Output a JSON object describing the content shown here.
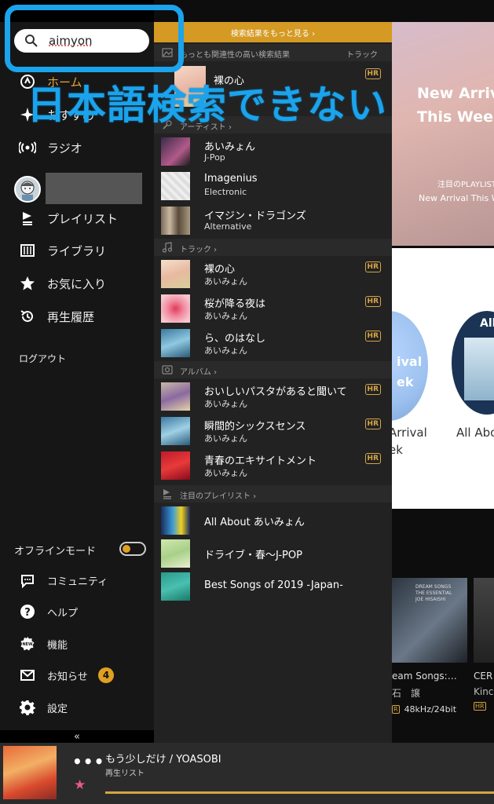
{
  "search": {
    "value": "aimyon",
    "placeholder": ""
  },
  "overlay_caption": "日本語検索できない",
  "sidebar": {
    "nav_top": [
      {
        "label": "ホーム",
        "icon": "home-icon"
      },
      {
        "label": "おすすめ",
        "icon": "sparkle-icon"
      },
      {
        "label": "ラジオ",
        "icon": "radio-icon"
      }
    ],
    "nav_library": [
      {
        "label": "プレイリスト",
        "icon": "playlist-icon"
      },
      {
        "label": "ライブラリ",
        "icon": "library-icon"
      },
      {
        "label": "お気に入り",
        "icon": "star-icon"
      },
      {
        "label": "再生履歴",
        "icon": "history-icon"
      }
    ],
    "logout": "ログアウト",
    "offline_mode": {
      "label": "オフラインモード",
      "enabled": false
    },
    "nav_bottom": [
      {
        "label": "コミュニティ",
        "icon": "community-icon"
      },
      {
        "label": "ヘルプ",
        "icon": "help-icon"
      },
      {
        "label": "機能",
        "icon": "new-icon"
      },
      {
        "label": "お知らせ",
        "icon": "mail-icon",
        "badge": "4"
      },
      {
        "label": "設定",
        "icon": "gear-icon"
      }
    ],
    "collapse_label": "«"
  },
  "dropdown": {
    "more_results": "検索結果をもっと見る ›",
    "top_result": {
      "header": "もっとも関連性の高い検索結果",
      "type_label": "トラック",
      "item": {
        "title": "裸の心",
        "hr": "HR"
      }
    },
    "artists": {
      "header": "アーティスト ›",
      "items": [
        {
          "name": "あいみょん",
          "genre": "J-Pop"
        },
        {
          "name": "Imagenius",
          "genre": "Electronic"
        },
        {
          "name": "イマジン・ドラゴンズ",
          "genre": "Alternative"
        }
      ]
    },
    "tracks": {
      "header": "トラック ›",
      "items": [
        {
          "title": "裸の心",
          "artist": "あいみょん",
          "hr": "HR"
        },
        {
          "title": "桜が降る夜は",
          "artist": "あいみょん",
          "hr": "HR"
        },
        {
          "title": "ら、のはなし",
          "artist": "あいみょん",
          "hr": "HR"
        }
      ]
    },
    "albums": {
      "header": "アルバム ›",
      "items": [
        {
          "title": "おいしいパスタがあると聞いて",
          "artist": "あいみょん",
          "hr": "HR"
        },
        {
          "title": "瞬間的シックスセンス",
          "artist": "あいみょん",
          "hr": "HR"
        },
        {
          "title": "青春のエキサイトメント",
          "artist": "あいみょん",
          "hr": "HR"
        }
      ]
    },
    "playlists": {
      "header": "注目のプレイリスト ›",
      "items": [
        {
          "title": "All About あいみょん"
        },
        {
          "title": "ドライブ・春〜J-POP"
        },
        {
          "title": "Best Songs of 2019 -Japan-"
        }
      ]
    }
  },
  "background": {
    "banner_title_1": "New Arriv",
    "banner_title_2": "This Wee",
    "banner_sub_1": "注目のPLAYLIST",
    "banner_sub_2": "New Arrival This W",
    "circle_a_text_1": "ival",
    "circle_a_text_2": "ek",
    "circle_b_text": "All",
    "card_label_1a": "Arrival",
    "card_label_1b": "ek",
    "card_label_2": "All Abo",
    "album_1": {
      "cover_text_1": "DREAM SONGS",
      "cover_text_2": "THE ESSENTIAL",
      "cover_text_3": "JOE HISAISHI",
      "name": "eam Songs:…",
      "artist": "石　譲",
      "quality": "48kHz/24bit"
    },
    "album_2": {
      "name": "CER",
      "artist": "Kinc"
    }
  },
  "player": {
    "title": "もう少しだけ / YOASOBI",
    "subtitle": "再生リスト",
    "more": "•••",
    "fav": "★",
    "progress": 1.0
  }
}
